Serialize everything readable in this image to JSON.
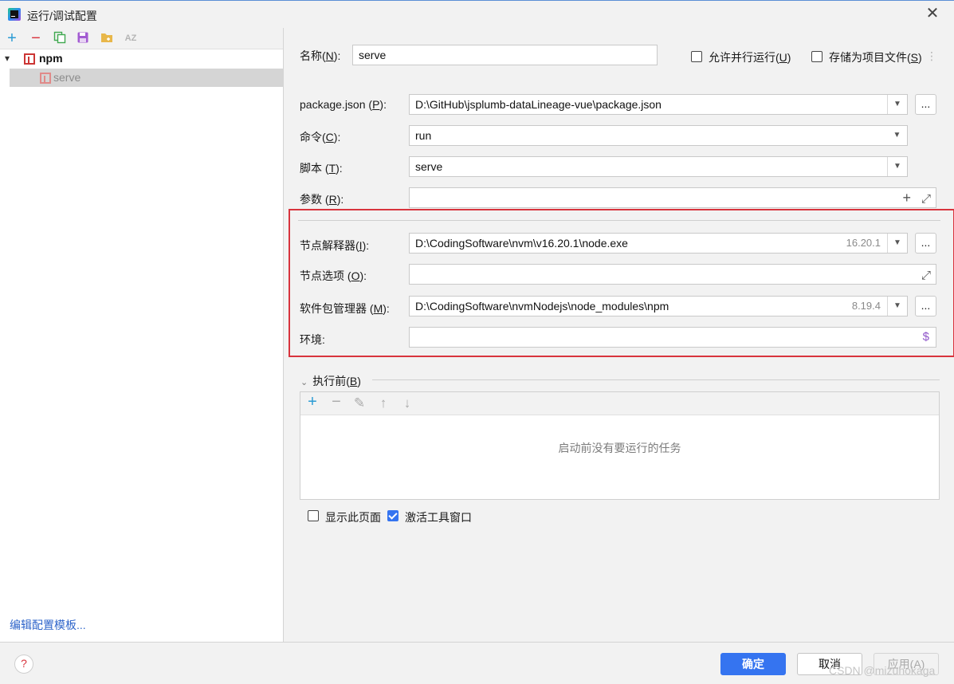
{
  "window": {
    "title": "运行/调试配置"
  },
  "left": {
    "toolbar_icons": [
      "add-icon",
      "remove-icon",
      "copy-icon",
      "save-icon",
      "new-folder-icon",
      "sort-icon"
    ],
    "tree": {
      "group": "npm",
      "child": "serve"
    },
    "edit_templates": "编辑配置模板..."
  },
  "form": {
    "name_label": "名称(",
    "name_mnemonic": "N",
    "name_label_end": "):",
    "name_value": "serve",
    "allow_parallel": "允许并行运行(",
    "allow_parallel_mn": "U",
    "store_as_file": "存储为项目文件(",
    "store_as_file_mn": "S",
    "package_json_label": "package.json (",
    "package_json_mn": "P",
    "package_json_value": "D:\\GitHub\\jsplumb-dataLineage-vue\\package.json",
    "command_label": "命令(",
    "command_mn": "C",
    "command_value": "run",
    "script_label": "脚本 (",
    "script_mn": "T",
    "script_value": "serve",
    "args_label": "参数 (",
    "args_mn": "R",
    "args_value": "",
    "node_interp_label": "节点解释器(",
    "node_interp_mn": "I",
    "node_interp_value": "D:\\CodingSoftware\\nvm\\v16.20.1\\node.exe",
    "node_interp_version": "16.20.1",
    "node_options_label": "节点选项 (",
    "node_options_mn": "O",
    "node_options_value": "",
    "pkg_manager_label": "软件包管理器 (",
    "pkg_manager_mn": "M",
    "pkg_manager_value": "D:\\CodingSoftware\\nvmNodejs\\node_modules\\npm",
    "pkg_manager_version": "8.19.4",
    "env_label": "环境:",
    "env_value": "",
    "close_paren": "):",
    "dots": "...",
    "before_launch_label": "执行前(",
    "before_launch_mn": "B",
    "before_launch_end": ")",
    "before_launch_empty": "启动前没有要运行的任务",
    "show_page": "显示此页面",
    "activate_tool": "激活工具窗口"
  },
  "buttons": {
    "ok": "确定",
    "cancel": "取消",
    "apply": "应用(A)"
  },
  "watermark": "CSDN @mizuhokaga"
}
